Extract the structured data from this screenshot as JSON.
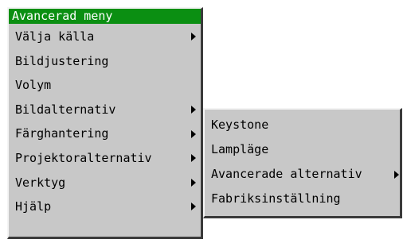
{
  "main_menu": {
    "title": "Avancerad meny",
    "items": [
      {
        "label": "Välja källa",
        "submenu": true
      },
      {
        "label": "Bildjustering",
        "submenu": false
      },
      {
        "label": "Volym",
        "submenu": false
      },
      {
        "label": "Bildalternativ",
        "submenu": true
      },
      {
        "label": "Färghantering",
        "submenu": true
      },
      {
        "label": "Projektoralternativ",
        "submenu": true
      },
      {
        "label": "Verktyg",
        "submenu": true
      },
      {
        "label": "Hjälp",
        "submenu": true
      }
    ]
  },
  "sub_menu": {
    "items": [
      {
        "label": "Keystone",
        "submenu": false
      },
      {
        "label": "Lampläge",
        "submenu": false
      },
      {
        "label": "Avancerade alternativ",
        "submenu": true
      },
      {
        "label": "Fabriksinställning",
        "submenu": false
      }
    ]
  },
  "colors": {
    "menu_background": "#c8c8c8",
    "title_background": "#0b8f12",
    "title_text": "#ffffff",
    "text": "#000000"
  },
  "icons": {
    "submenu_indicator": "arrow-right-icon"
  }
}
